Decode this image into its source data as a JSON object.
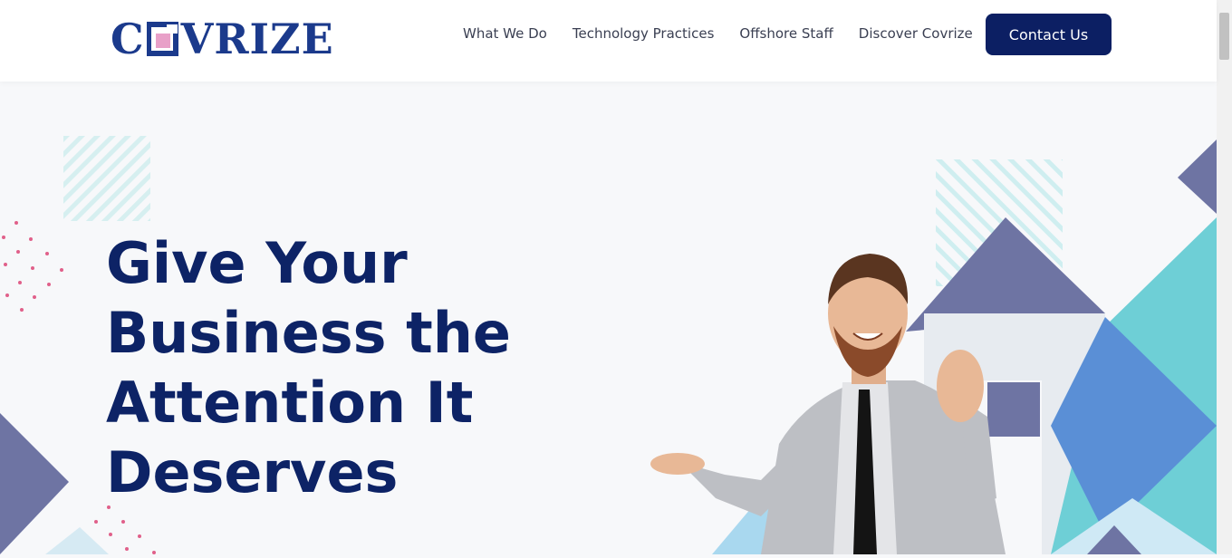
{
  "brand": {
    "logo_text_left": "C",
    "logo_text_right": "VRIZE"
  },
  "nav": {
    "items": [
      {
        "label": "What We Do"
      },
      {
        "label": "Technology Practices"
      },
      {
        "label": "Offshore Staff"
      },
      {
        "label": "Discover Covrize"
      }
    ],
    "cta_label": "Contact Us"
  },
  "hero": {
    "title_lines": [
      "Give Your",
      "Business the",
      "Attention It",
      "Deserves"
    ]
  },
  "colors": {
    "brand_navy": "#0c1f63",
    "heading": "#0d2366",
    "accent_teal": "#5ec8d0",
    "accent_slate": "#6e74a3",
    "accent_blue": "#5a8fd6",
    "accent_pink": "#e0608a"
  }
}
